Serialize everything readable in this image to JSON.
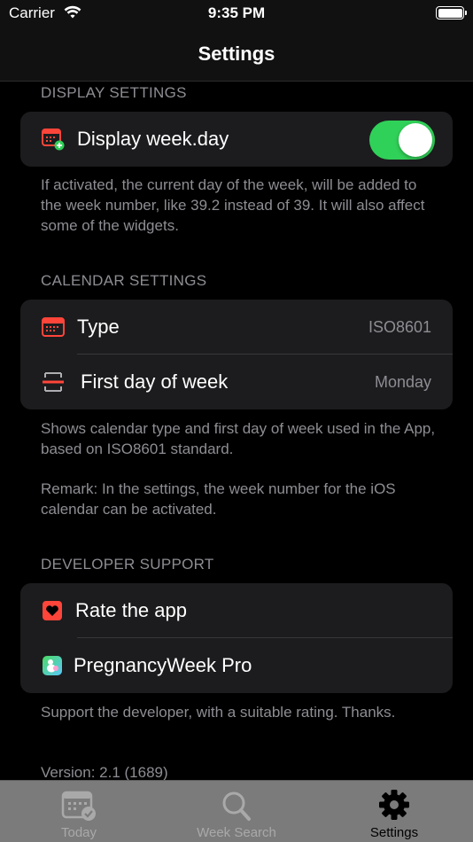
{
  "status_bar": {
    "carrier": "Carrier",
    "time": "9:35 PM"
  },
  "nav": {
    "title": "Settings"
  },
  "display_settings": {
    "header": "DISPLAY SETTINGS",
    "row_label": "Display week.day",
    "toggle_on": true,
    "footer": "If activated, the current day of the week, will be added to the week number, like 39.2 instead of 39. It will also affect some of the widgets."
  },
  "calendar_settings": {
    "header": "CALENDAR SETTINGS",
    "rows": [
      {
        "label": "Type",
        "value": "ISO8601"
      },
      {
        "label": "First day of week",
        "value": "Monday"
      }
    ],
    "footer": "Shows calendar type and first day of week used in the App, based on ISO8601 standard.",
    "remark": "Remark: In the settings, the week number for the iOS calendar can be activated."
  },
  "developer_support": {
    "header": "DEVELOPER SUPPORT",
    "rows": [
      {
        "label": "Rate the app"
      },
      {
        "label": "PregnancyWeek Pro"
      }
    ],
    "footer": "Support the developer, with a suitable rating. Thanks.",
    "version": "Version: 2.1 (1689)"
  },
  "tabs": [
    {
      "label": "Today",
      "icon": "calendar-check-icon"
    },
    {
      "label": "Week Search",
      "icon": "magnifier-icon"
    },
    {
      "label": "Settings",
      "icon": "gear-icon",
      "active": true
    }
  ],
  "colors": {
    "toggle_on": "#30d158",
    "icon_red": "#ff453a",
    "background": "#000000",
    "cell": "#1c1c1e"
  }
}
